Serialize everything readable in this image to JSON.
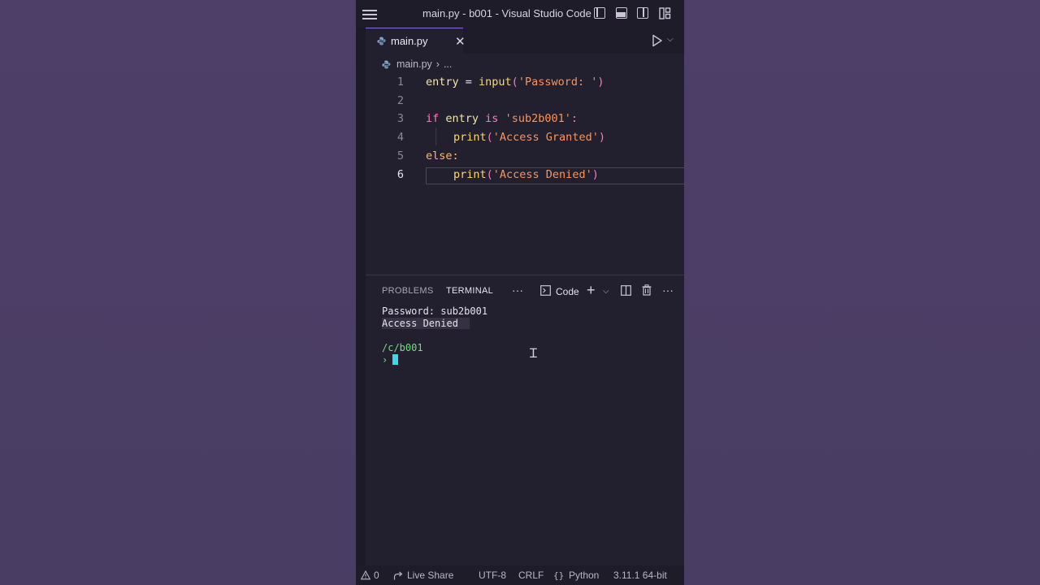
{
  "window": {
    "title": "main.py - b001 - Visual Studio Code"
  },
  "tab": {
    "label": "main.py",
    "close": "✕"
  },
  "breadcrumb": {
    "file": "main.py",
    "sep": "›",
    "more": "..."
  },
  "editor": {
    "lines": [
      {
        "num": "1"
      },
      {
        "num": "2"
      },
      {
        "num": "3"
      },
      {
        "num": "4"
      },
      {
        "num": "5"
      },
      {
        "num": "6"
      }
    ],
    "tokens": {
      "l1_entry": "entry",
      "l1_eq": " = ",
      "l1_input": "input",
      "l1_paren_open": "(",
      "l1_str": "'Password: '",
      "l1_paren_close": ")",
      "l3_if": "if",
      "l3_entry": " entry ",
      "l3_is": "is",
      "l3_str": " 'sub2b001'",
      "l3_colon": ":",
      "l4_print": "print",
      "l4_open": "(",
      "l4_str": "'Access Granted'",
      "l4_close": ")",
      "l5_else": "else",
      "l5_colon": ":",
      "l6_print": "print",
      "l6_open": "(",
      "l6_str": "'Access Denied'",
      "l6_close": ")"
    }
  },
  "panel": {
    "tabs": [
      "PROBLEMS",
      "TERMINAL"
    ],
    "active_tab": "TERMINAL",
    "more": "···",
    "shell_label": "Code",
    "plus": "+",
    "ellipsis": "···"
  },
  "terminal": {
    "line1": "Password: sub2b001",
    "line2": "Access Denied",
    "path": "/c/b001",
    "prompt": "›"
  },
  "status": {
    "warnings": "0",
    "live_share": "Live Share",
    "encoding": "UTF-8",
    "eol": "CRLF",
    "language": "Python",
    "interpreter": "3.11.1 64-bit"
  },
  "colors": {
    "accent": "#8e6ad6",
    "background": "#4c3f66",
    "editor_bg": "#221f2e",
    "keyword": "#ff79c6",
    "string": "#f7955c",
    "function": "#ffd866",
    "terminal_green": "#6fe07a",
    "cursor": "#3fd6e6"
  }
}
